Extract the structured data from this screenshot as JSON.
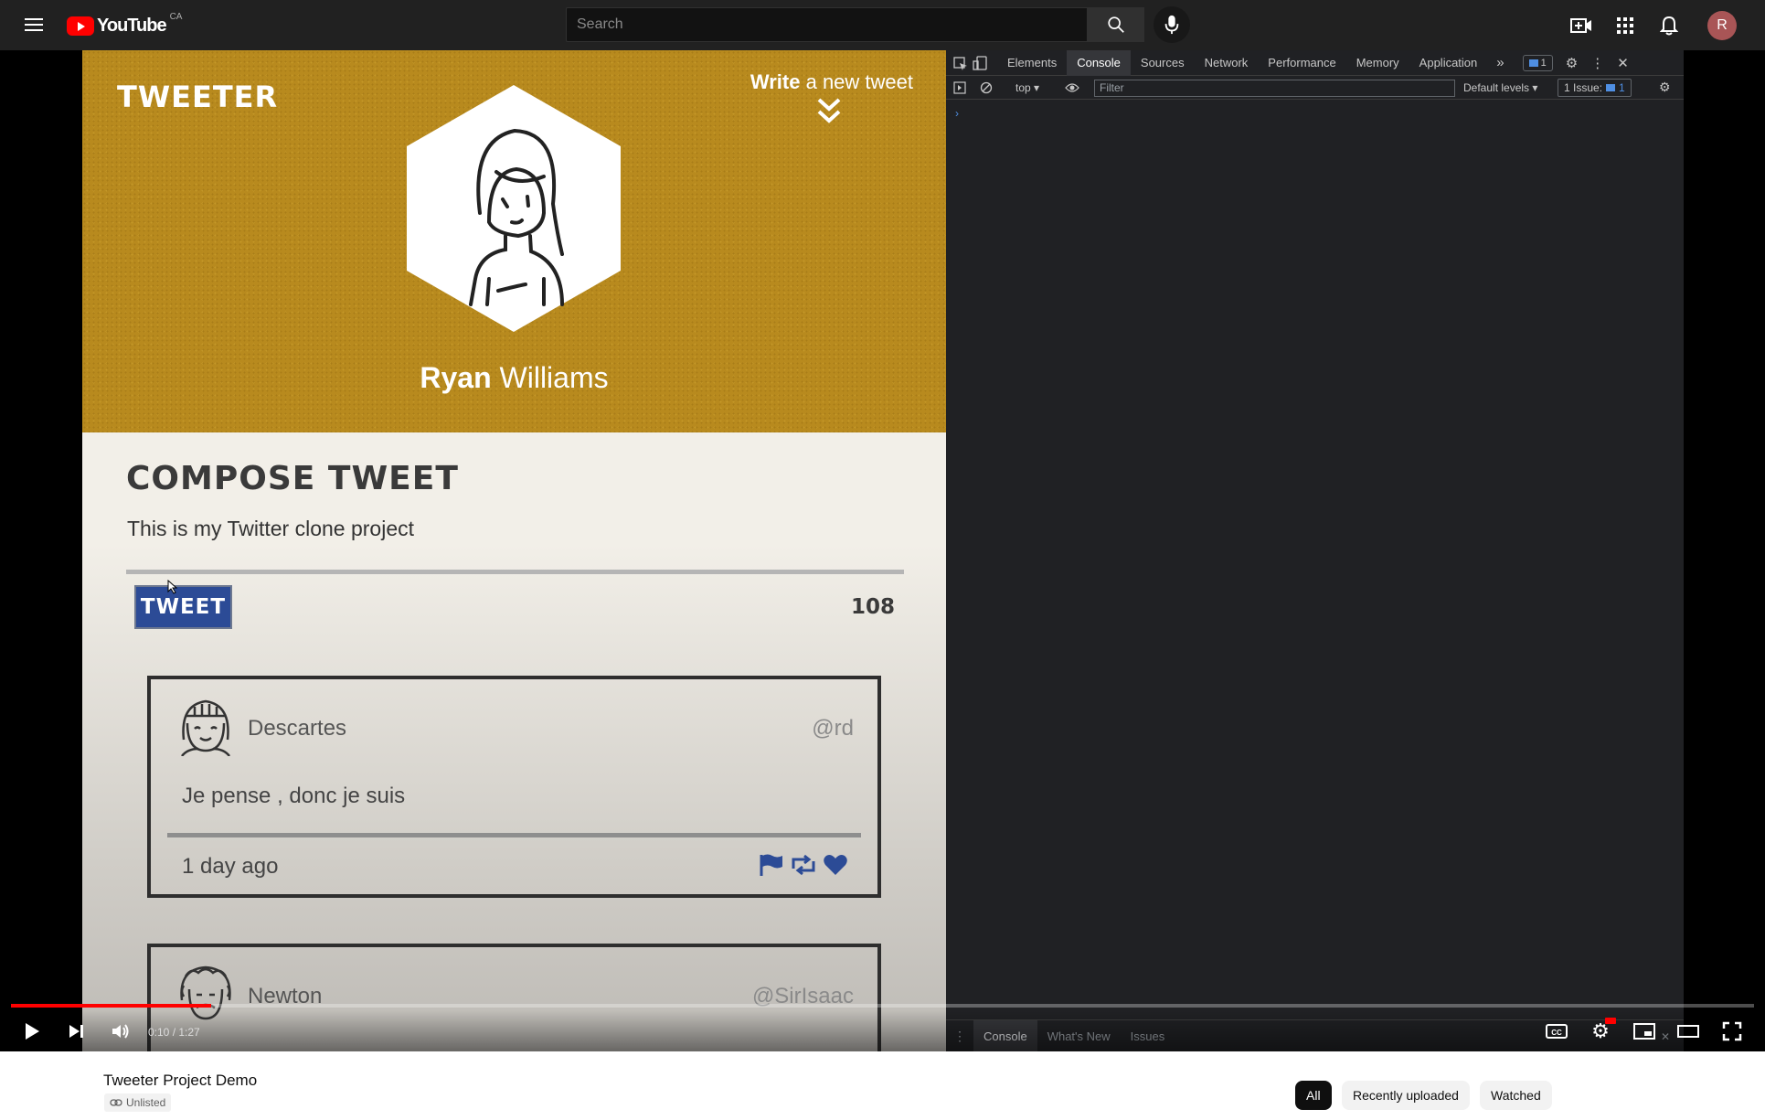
{
  "header": {
    "logo_text": "YouTube",
    "country_code": "CA",
    "search_placeholder": "Search",
    "avatar_letter": "R"
  },
  "tweeter": {
    "brand": "TWEETER",
    "write_prefix": "Write",
    "write_suffix": " a new tweet",
    "user_first": "Ryan",
    "user_last": " Williams",
    "compose_title": "COMPOSE TWEET",
    "compose_text": "This is my Twitter clone project",
    "tweet_button": "TWEET",
    "char_counter": "108",
    "tweets": [
      {
        "name": "Descartes",
        "handle": "@rd",
        "body": "Je pense , donc je suis",
        "time": "1 day ago"
      },
      {
        "name": "Newton",
        "handle": "@SirIsaac"
      }
    ],
    "accent_color": "#b88a1e",
    "button_color": "#2c4b96"
  },
  "devtools": {
    "tabs": [
      "Elements",
      "Console",
      "Sources",
      "Network",
      "Performance",
      "Memory",
      "Application"
    ],
    "active_tab": "Console",
    "message_count": "1",
    "context": "top",
    "filter_placeholder": "Filter",
    "levels": "Default levels",
    "issues_label": "1 Issue:",
    "issues_count": "1",
    "drawer_tabs": [
      "Console",
      "What's New",
      "Issues"
    ]
  },
  "player": {
    "time": "0:10 / 1:27",
    "progress_fraction": 0.115
  },
  "video": {
    "title": "Tweeter Project Demo",
    "visibility": "Unlisted",
    "chips": [
      "All",
      "Recently uploaded",
      "Watched"
    ]
  }
}
